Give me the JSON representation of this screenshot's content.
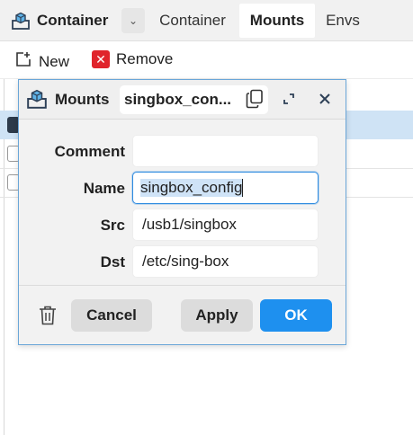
{
  "topbar": {
    "app_title": "Container",
    "tabs": [
      "Container",
      "Mounts",
      "Envs"
    ],
    "active_tab": "Mounts"
  },
  "toolbar": {
    "new_label": "New",
    "remove_label": "Remove"
  },
  "dialog": {
    "title": "Mounts",
    "name_display": "singbox_con...",
    "fields": {
      "comment_label": "Comment",
      "comment_value": "",
      "name_label": "Name",
      "name_value": "singbox_config",
      "src_label": "Src",
      "src_value": "/usb1/singbox",
      "dst_label": "Dst",
      "dst_value": "/etc/sing-box"
    },
    "buttons": {
      "cancel": "Cancel",
      "apply": "Apply",
      "ok": "OK"
    }
  },
  "colors": {
    "accent": "#1e90ef",
    "remove": "#e0242c",
    "selection": "#cfe3f5"
  }
}
